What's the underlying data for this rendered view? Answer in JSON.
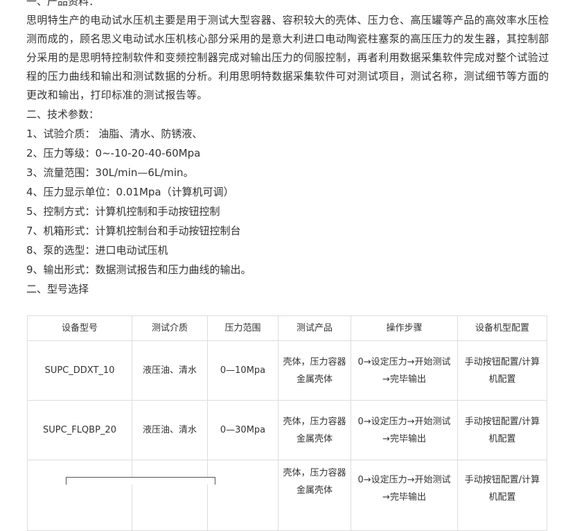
{
  "section1": {
    "heading": "一、产品资料：",
    "paragraph": "思明特生产的电动试水压机主要是用于测试大型容器、容积较大的壳体、压力仓、高压罐等产品的高效率水压检测而成的，顾名思义电动试水压机核心部分采用的是意大利进口电动陶瓷柱塞泵的高压压力的发生器，其控制部分采用的是思明特控制软件和变频控制器完成对输出压力的伺服控制，再者利用数据采集软件完成对整个试验过程的压力曲线和输出和测试数据的分析。利用思明特数据采集软件可对测试项目，测试名称，测试细节等方面的更改和输出，打印标准的测试报告等。"
  },
  "section2": {
    "heading": "二、技术参数：",
    "params": [
      "1、试验介质： 油脂、清水、防锈液、",
      "2、压力等级：0~-10-20-40-60Mpa",
      "3、流量范围：30L/min—6L/min。",
      "4、压力显示单位：0.01Mpa（计算机可调）",
      "5、控制方式：计算机控制和手动按钮控制",
      "7、机箱形式：计算机控制台和手动按钮控制台",
      "8、泵的选型：进口电动试压机",
      "9、输出形式：数据测试报告和压力曲线的输出。"
    ]
  },
  "section3": {
    "heading": "二、型号选择"
  },
  "table": {
    "headers": [
      "设备型号",
      "测试介质",
      "压力范围",
      "测试产品",
      "操作步骤",
      "设备机型配置"
    ],
    "rows": [
      [
        "SUPC_DDXT_10",
        "液压油、清水",
        "0—10Mpa",
        "壳体，压力容器\n金属壳体",
        "0→设定压力→开始测试→完毕输出",
        "手动按钮配置/计算机配置"
      ],
      [
        "SUPC_FLQBP_20",
        "液压油、清水",
        "0—30Mpa",
        "壳体，压力容器\n金属壳体",
        "0→设定压力→开始测试→完毕输出",
        "手动按钮配置/计算机配置"
      ],
      [
        "",
        "",
        "",
        "壳体，压力容器\n金属壳体",
        "0→设定压力→开始测试→完毕输出",
        "手动按钮配置/计算机配置"
      ]
    ]
  }
}
